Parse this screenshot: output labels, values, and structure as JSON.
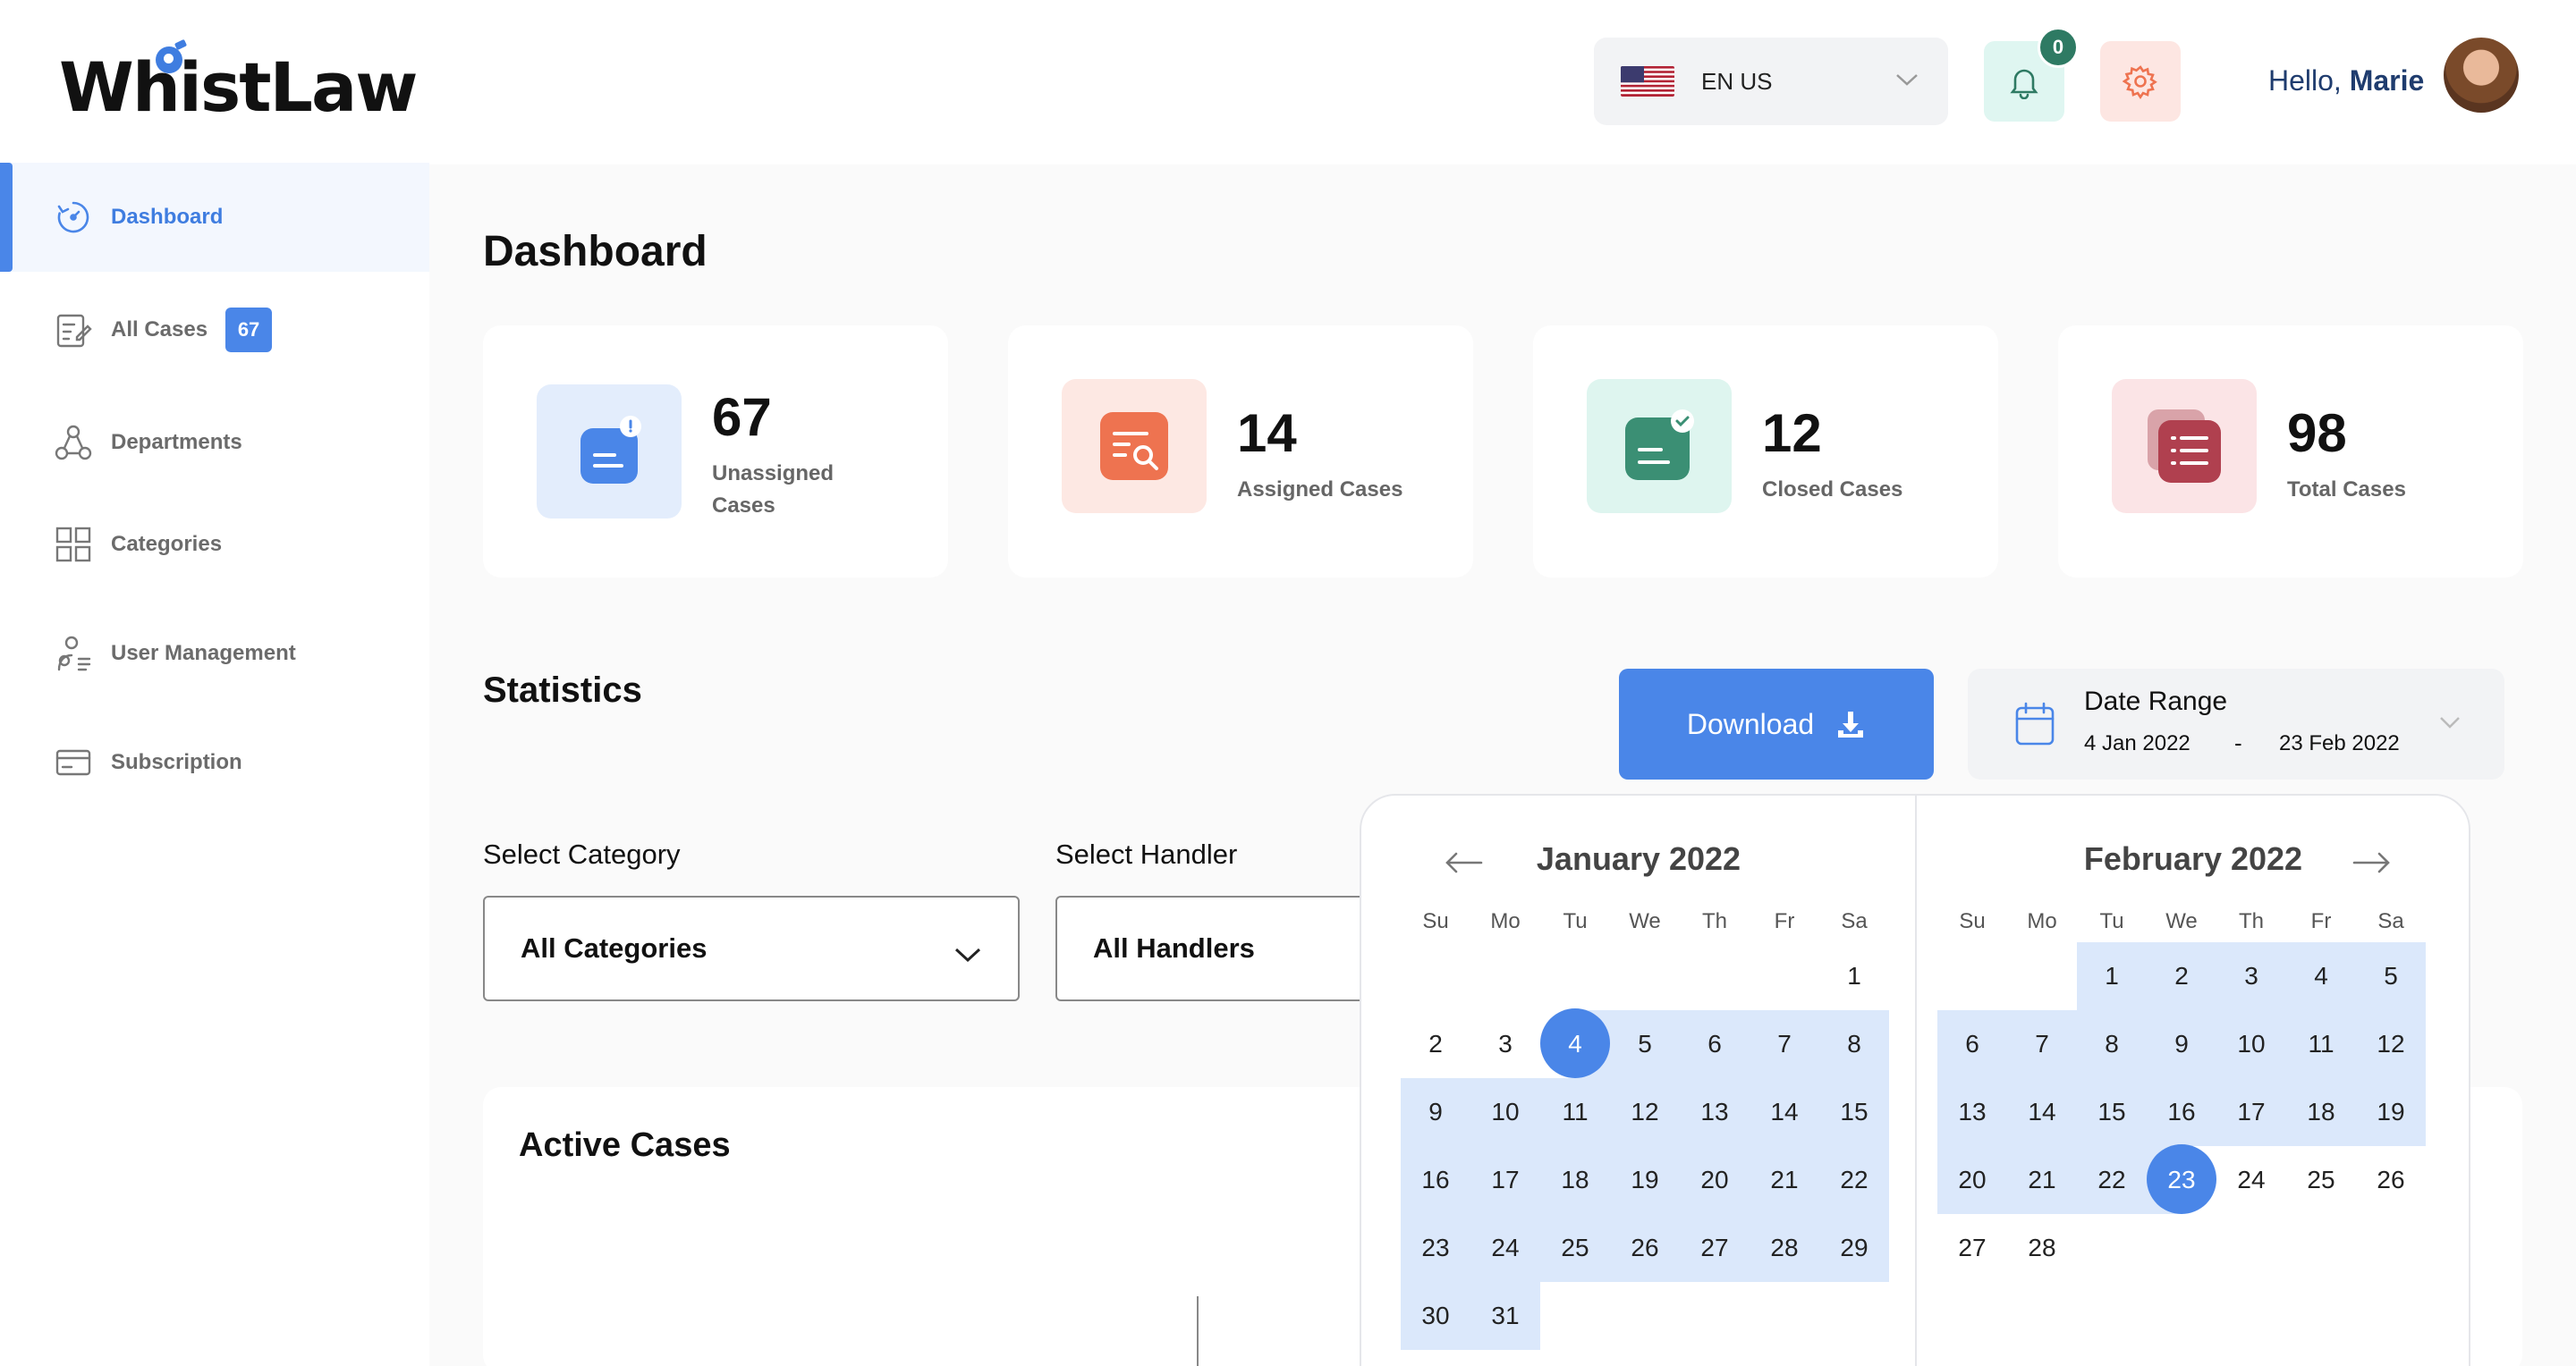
{
  "brand": {
    "name": "WhistLaw"
  },
  "sidebar": {
    "items": [
      {
        "label": "Dashboard",
        "icon": "dashboard-icon",
        "active": true
      },
      {
        "label": "All Cases",
        "icon": "cases-icon",
        "badge": "67"
      },
      {
        "label": "Departments",
        "icon": "departments-icon"
      },
      {
        "label": "Categories",
        "icon": "categories-icon"
      },
      {
        "label": "User Management",
        "icon": "user-management-icon"
      },
      {
        "label": "Subscription",
        "icon": "subscription-icon"
      }
    ]
  },
  "header": {
    "language": "EN US",
    "notifications_count": "0",
    "greeting": "Hello,",
    "user_name": "Marie"
  },
  "page": {
    "title": "Dashboard"
  },
  "stats_cards": [
    {
      "value": "67",
      "label_line1": "Unassigned",
      "label_line2": "Cases",
      "color": "#4a86e8",
      "bg": "#e3edfc"
    },
    {
      "value": "14",
      "label_line1": "Assigned Cases",
      "color": "#ee7350",
      "bg": "#fde8e3"
    },
    {
      "value": "12",
      "label_line1": "Closed Cases",
      "color": "#3b8f74",
      "bg": "#def5ef"
    },
    {
      "value": "98",
      "label_line1": "Total Cases",
      "color": "#b0404f",
      "bg": "#fbe4e6"
    }
  ],
  "statistics": {
    "title": "Statistics",
    "download_label": "Download",
    "date_range": {
      "title": "Date Range",
      "start": "4 Jan 2022",
      "separator": "-",
      "end": "23 Feb 2022"
    },
    "filters": {
      "category_label": "Select Category",
      "category_value": "All Categories",
      "handler_label": "Select Handler",
      "handler_value": "All Handlers"
    }
  },
  "active_cases": {
    "title": "Active Cases"
  },
  "calendar": {
    "weekdays": [
      "Su",
      "Mo",
      "Tu",
      "We",
      "Th",
      "Fr",
      "Sa"
    ],
    "left": {
      "title": "January 2022",
      "first_weekday": 6,
      "days": 31,
      "selected": 4,
      "range_from": 4,
      "range_to": 31
    },
    "right": {
      "title": "February 2022",
      "first_weekday": 2,
      "days": 28,
      "selected": 23,
      "range_from": 1,
      "range_to": 23
    },
    "accent": "#4a86e8",
    "range_bg": "#dbe8fb"
  }
}
